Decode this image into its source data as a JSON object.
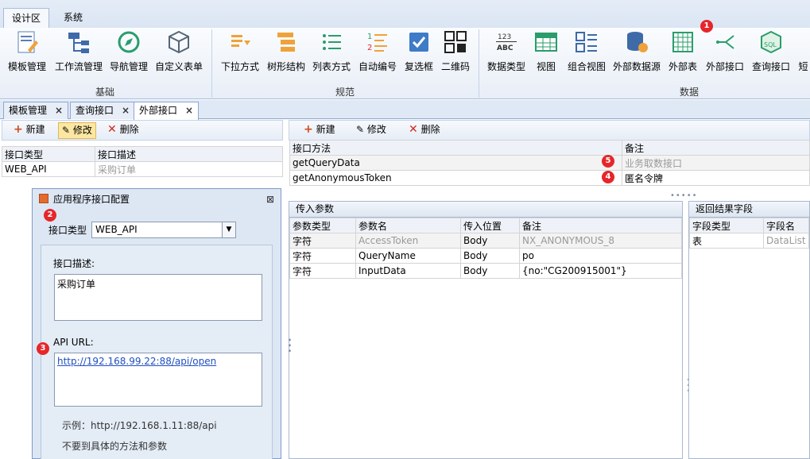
{
  "ribbon_tabs": [
    "设计区",
    "系统"
  ],
  "groups": {
    "basic": {
      "label": "基础",
      "items": [
        "模板管理",
        "工作流管理",
        "导航管理",
        "自定义表单"
      ]
    },
    "spec": {
      "label": "规范",
      "items": [
        "下拉方式",
        "树形结构",
        "列表方式",
        "自动编号",
        "复选框",
        "二维码"
      ]
    },
    "data": {
      "label": "数据",
      "items": [
        "数据类型",
        "视图",
        "组合视图",
        "外部数据源",
        "外部表",
        "外部接口",
        "查询接口",
        "短"
      ]
    }
  },
  "doc_tabs": [
    "模板管理",
    "查询接口",
    "外部接口"
  ],
  "toolbar": {
    "new": "新建",
    "edit": "修改",
    "delete": "删除"
  },
  "left_grid": {
    "headers": [
      "接口类型",
      "接口描述"
    ],
    "rows": [
      [
        "WEB_API",
        "采购订单"
      ]
    ]
  },
  "methods_grid": {
    "headers": [
      "接口方法",
      "备注"
    ],
    "rows": [
      [
        "getQueryData",
        "业务取数接口"
      ],
      [
        "getAnonymousToken",
        "匿名令牌"
      ]
    ]
  },
  "params_panel": {
    "title": "传入参数",
    "headers": [
      "参数类型",
      "参数名",
      "传入位置",
      "备注"
    ],
    "rows": [
      [
        "字符",
        "AccessToken",
        "Body",
        "NX_ANONYMOUS_8"
      ],
      [
        "字符",
        "QueryName",
        "Body",
        "po"
      ],
      [
        "字符",
        "InputData",
        "Body",
        "{no:\"CG200915001\"}"
      ]
    ]
  },
  "result_panel": {
    "title": "返回结果字段",
    "headers": [
      "字段类型",
      "字段名"
    ],
    "rows": [
      [
        "表",
        "DataList"
      ]
    ]
  },
  "dialog": {
    "title": "应用程序接口配置",
    "type_label": "接口类型",
    "type_value": "WEB_API",
    "desc_label": "接口描述:",
    "desc_value": "采购订单",
    "url_label": "API URL:",
    "url_value": "http://192.168.99.22:88/api/open",
    "example": "示例：http://192.168.1.11:88/api",
    "note": "不要到具体的方法和参数"
  },
  "badges": [
    "1",
    "2",
    "3",
    "4",
    "5"
  ],
  "colors": {
    "badge": "#e6262a",
    "accent": "#1f4fc1"
  }
}
